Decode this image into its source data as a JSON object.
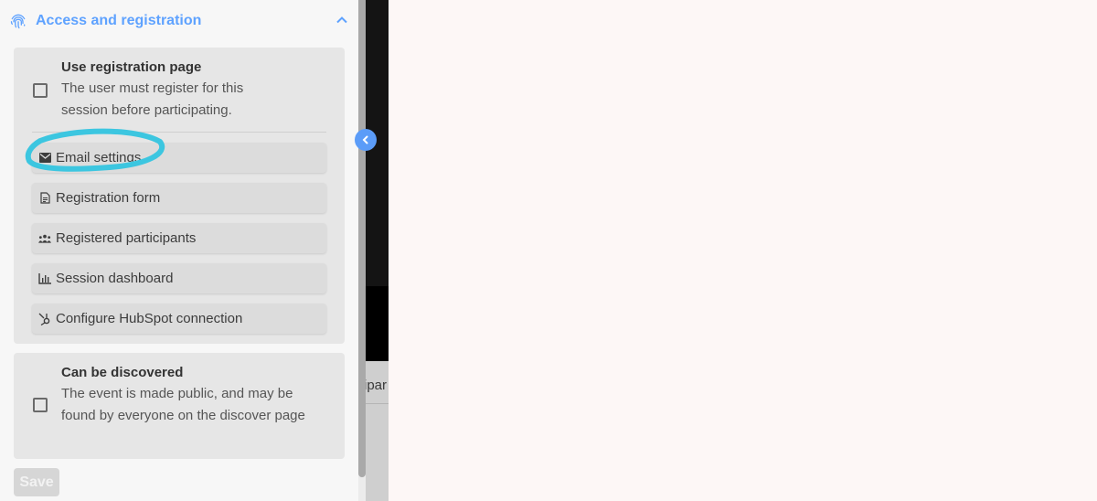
{
  "sidebar": {
    "section": {
      "title": "Access and registration",
      "icon": "fingerprint-icon",
      "expanded": true,
      "accent_color": "#5ea2ff"
    },
    "registration_option": {
      "title": "Use registration page",
      "description": "The user must register for this session before participating.",
      "checked": false
    },
    "actions": [
      {
        "label": "Email settings",
        "icon": "email-icon"
      },
      {
        "label": "Registration form",
        "icon": "document-icon"
      },
      {
        "label": "Registered participants",
        "icon": "people-icon"
      },
      {
        "label": "Session dashboard",
        "icon": "bar-chart-icon"
      },
      {
        "label": "Configure HubSpot connection",
        "icon": "hubspot-icon"
      }
    ],
    "discover_option": {
      "title": "Can be discovered",
      "description": "The event is made public, and may be found by everyone on the discover page",
      "checked": false
    },
    "save_label": "Save"
  },
  "middle": {
    "partial_tab_text": "ipar"
  },
  "annotation": {
    "color": "#3cc6e0",
    "target": "Email settings"
  }
}
